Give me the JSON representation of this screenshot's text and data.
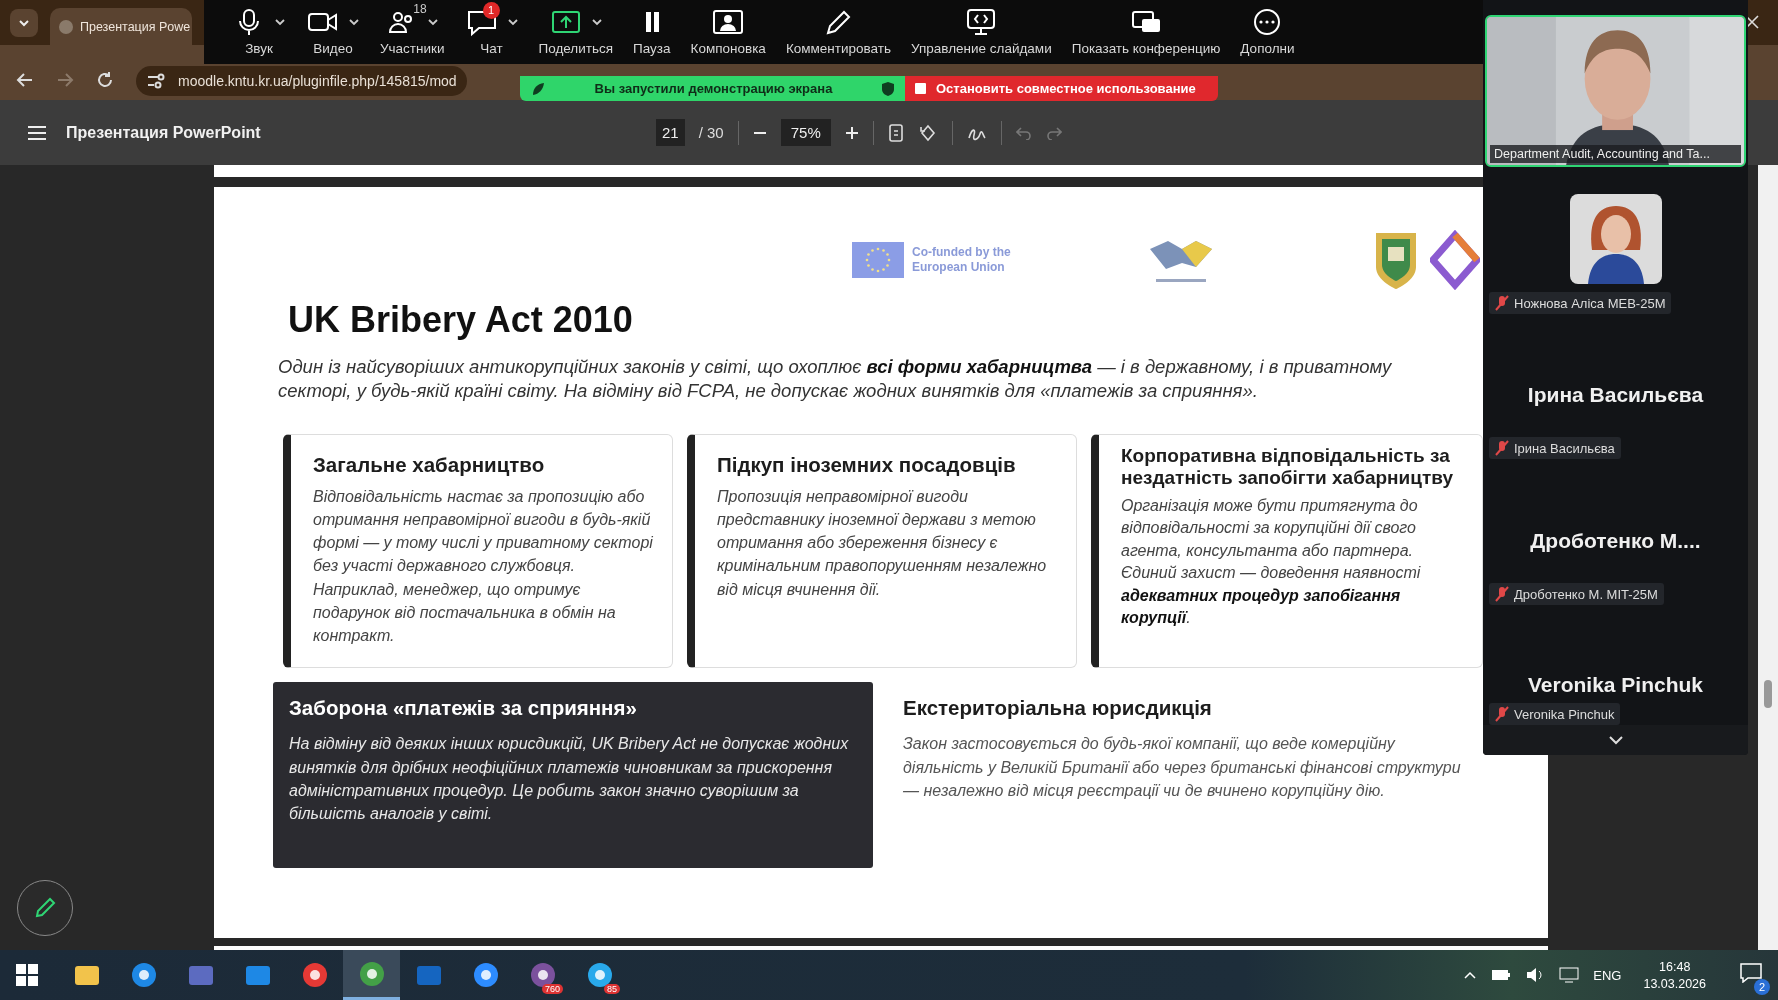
{
  "browser": {
    "tab_title": "Презентация Powe",
    "url": "moodle.kntu.kr.ua/pluginfile.php/145815/mod"
  },
  "meeting_toolbar": {
    "buttons": [
      {
        "kind": "mic",
        "label": "Звук",
        "caret": true
      },
      {
        "kind": "camera",
        "label": "Видео",
        "caret": true
      },
      {
        "kind": "people",
        "label": "Участники",
        "caret": true,
        "count": "18"
      },
      {
        "kind": "chat",
        "label": "Чат",
        "caret": true,
        "badge": "1"
      },
      {
        "kind": "share",
        "label": "Поделиться",
        "caret": true
      },
      {
        "kind": "pause",
        "label": "Пауза",
        "caret": false
      },
      {
        "kind": "layout",
        "label": "Компоновка",
        "caret": false
      },
      {
        "kind": "pencil",
        "label": "Комментировать",
        "caret": false
      },
      {
        "kind": "slides",
        "label": "Управление слайдами",
        "caret": false
      },
      {
        "kind": "conference",
        "label": "Показать конференцию",
        "caret": false
      },
      {
        "kind": "more",
        "label": "Дополни",
        "caret": false
      }
    ]
  },
  "share_banner": {
    "status": "Вы запустили демонстрацию экрана",
    "stop_label": "Остановить совместное использование"
  },
  "pdf_toolbar": {
    "title": "Презентация PowerPoint",
    "page": "21",
    "total": "/ 30",
    "zoom": "75%"
  },
  "slide": {
    "logo_text": "Co-funded by the European Union",
    "title": "UK Bribery Act 2010",
    "intro": "Один із найсуворіших антикорупційних законів у світі, що охоплює **всі форми хабарництва** — і в державному, і в приватному секторі, у будь-якій країні світу. На відміну від FCPA, не допускає жодних винятків для «платежів за сприяння».",
    "cards": [
      {
        "heading": "Загальне хабарництво",
        "body": "Відповідальність настає за пропозицію або отримання неправомірної вигоди в будь-якій формі — у тому числі у приватному секторі без участі державного службовця. Наприклад, менеджер, що отримує подарунок від постачальника в обмін на контракт."
      },
      {
        "heading": "Підкуп іноземних посадовців",
        "body": "Пропозиція неправомірної вигоди представнику іноземної держави з метою отримання або збереження бізнесу є кримінальним правопорушенням незалежно від місця вчинення дії."
      },
      {
        "heading": "Корпоративна відповідальність за нездатність запобігти хабарництву",
        "body": "Організація може бути притягнута до відповідальності за корупційні дії свого агента, консультанта або партнера. Єдиний захист — доведення наявності **адекватних процедур запобігання корупції**."
      }
    ],
    "blocks": [
      {
        "kind": "dark",
        "heading": "Заборона «платежів за сприяння»",
        "body": "На відміну від деяких інших юрисдикцій, UK Bribery Act не допускає жодних винятків для дрібних неофіційних платежів чиновникам за прискорення адміністративних процедур. Це робить закон значно суворішим за більшість аналогів у світі."
      },
      {
        "kind": "plain",
        "heading": "Екстериторіальна юрисдикція",
        "body": "Закон застосовується до будь-якої компанії, що веде комерційну діяльність у Великій Британії або через британські фінансові структури — незалежно від місця реєстрації чи де вчинено корупційну дію."
      }
    ]
  },
  "participants": {
    "self_label": "Department Audit, Accounting and Ta...",
    "tiles": [
      {
        "label": "Ножнова Аліса МЕВ-25М",
        "muted": true
      },
      {
        "kind": "name",
        "display_name": "Ірина Васильєва",
        "label": "Ірина Васильєва",
        "muted": true
      },
      {
        "kind": "name",
        "display_name": "Дроботенко М....",
        "label": "Дроботенко М. MIT-25M",
        "muted": true
      },
      {
        "kind": "name",
        "display_name": "Veronika Pinchuk",
        "label": "Veronika Pinchuk",
        "muted": true
      }
    ]
  },
  "taskbar": {
    "apps": [
      {
        "kind": "folder",
        "selected": false
      },
      {
        "kind": "edge",
        "selected": false
      },
      {
        "kind": "store",
        "selected": false
      },
      {
        "kind": "mail",
        "selected": false
      },
      {
        "kind": "opera",
        "selected": false
      },
      {
        "kind": "chrome",
        "selected": true
      },
      {
        "kind": "tile",
        "selected": false
      },
      {
        "kind": "zoom",
        "selected": false
      },
      {
        "kind": "viber",
        "selected": false,
        "badge": "760"
      },
      {
        "kind": "telegram",
        "selected": false,
        "badge": "85"
      }
    ],
    "language": "ENG",
    "time": "16:48",
    "date": "13.03.2026",
    "notifications": "2"
  }
}
